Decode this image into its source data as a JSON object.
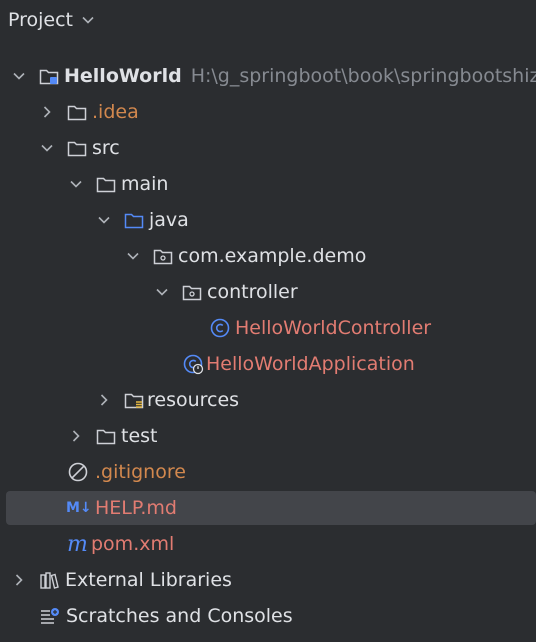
{
  "panel": {
    "title": "Project"
  },
  "tree": {
    "root": {
      "label": "HelloWorld",
      "path": "H:\\g_springboot\\book\\springbootshiz"
    },
    "idea": {
      "label": ".idea"
    },
    "src": {
      "label": "src"
    },
    "main": {
      "label": "main"
    },
    "java": {
      "label": "java"
    },
    "package": {
      "label": "com.example.demo"
    },
    "controller": {
      "label": "controller"
    },
    "controller_class": {
      "label": "HelloWorldController"
    },
    "application_class": {
      "label": "HelloWorldApplication"
    },
    "resources": {
      "label": "resources"
    },
    "test": {
      "label": "test"
    },
    "gitignore": {
      "label": ".gitignore"
    },
    "help": {
      "label": "HELP.md",
      "icon_text": "M↓"
    },
    "pom": {
      "label": "pom.xml",
      "icon_text": "m"
    },
    "external": {
      "label": "External Libraries"
    },
    "scratches": {
      "label": "Scratches and Consoles"
    }
  },
  "colors": {
    "background": "#2b2d30",
    "selection": "#43454a",
    "text": "#dfe1e5",
    "muted_path": "#868a91",
    "ignored_orange": "#d2884e",
    "changed_red": "#e27c72",
    "java_blue": "#548af7"
  },
  "icons": {
    "folder": "folder-icon",
    "module": "module-folder-icon",
    "source_root": "source-root-folder-icon",
    "package": "package-icon",
    "class": "java-class-icon",
    "spring_app": "spring-boot-application-icon",
    "resources": "resources-folder-icon",
    "ignore": "ignore-file-icon",
    "markdown": "markdown-icon",
    "maven": "maven-icon",
    "libraries": "external-libraries-icon",
    "scratches": "scratches-icon"
  }
}
